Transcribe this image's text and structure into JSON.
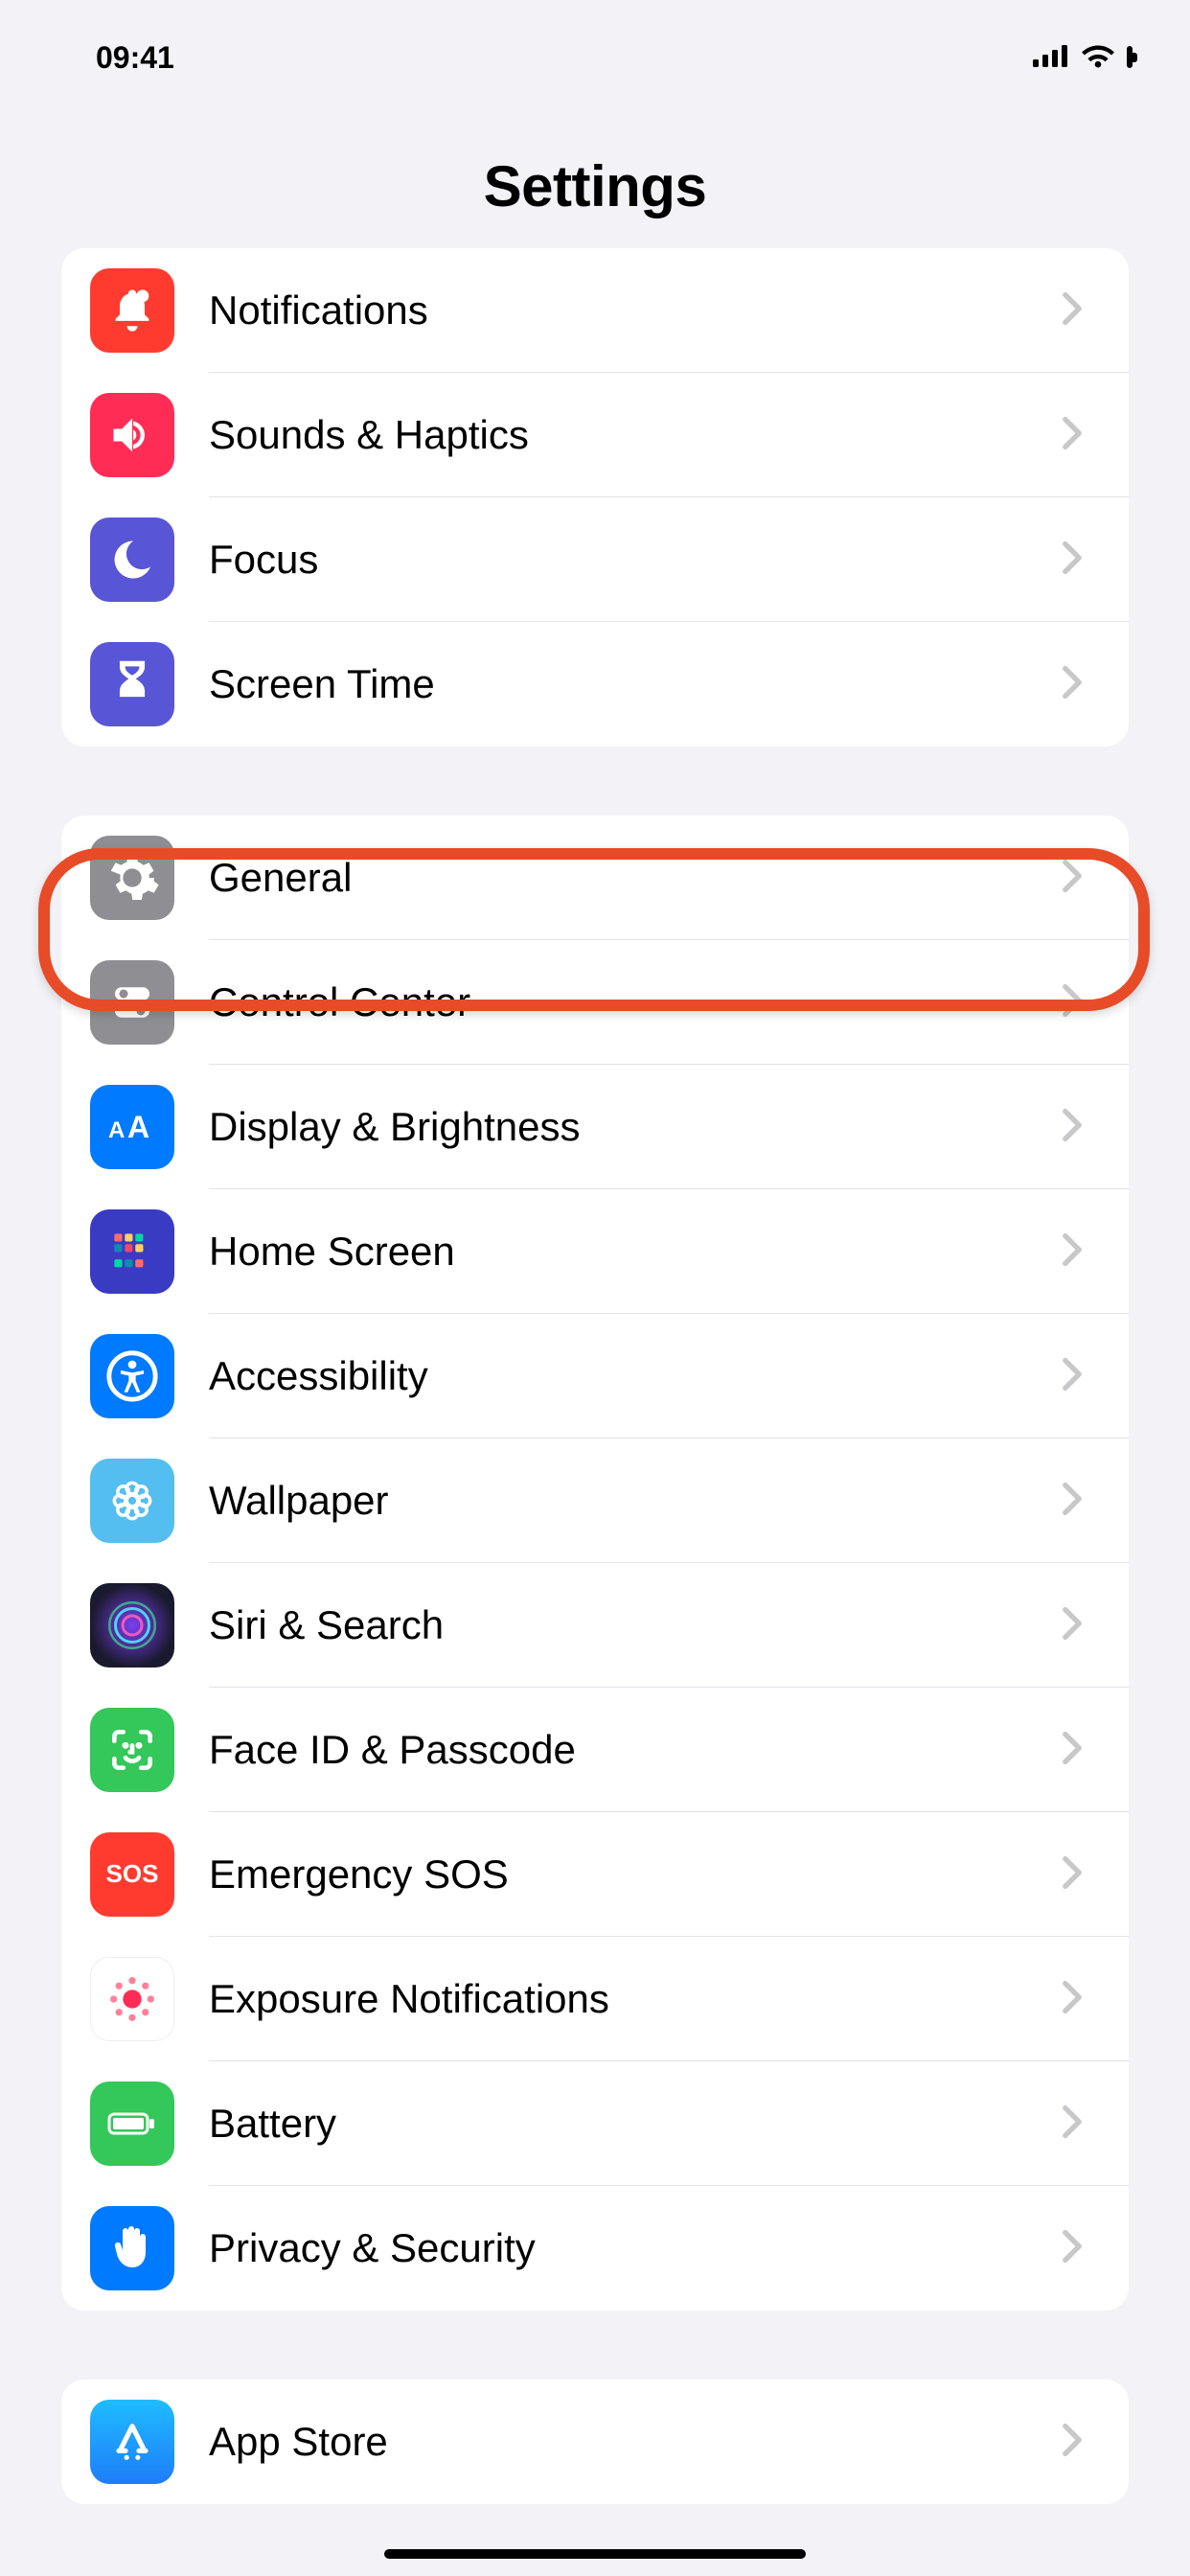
{
  "status": {
    "time": "09:41"
  },
  "header": {
    "title": "Settings"
  },
  "groups": [
    {
      "rows": [
        {
          "id": "notifications",
          "label": "Notifications",
          "icon": "bell-icon",
          "bg": "#ff3b30"
        },
        {
          "id": "sounds",
          "label": "Sounds & Haptics",
          "icon": "speaker-icon",
          "bg": "#ff2d55"
        },
        {
          "id": "focus",
          "label": "Focus",
          "icon": "moon-icon",
          "bg": "#5856d6"
        },
        {
          "id": "screentime",
          "label": "Screen Time",
          "icon": "hourglass-icon",
          "bg": "#5856d6"
        }
      ]
    },
    {
      "rows": [
        {
          "id": "general",
          "label": "General",
          "icon": "gear-icon",
          "bg": "#8e8e93",
          "highlight": true
        },
        {
          "id": "controlcenter",
          "label": "Control Center",
          "icon": "toggles-icon",
          "bg": "#8e8e93"
        },
        {
          "id": "display",
          "label": "Display & Brightness",
          "icon": "aa-icon",
          "bg": "#007aff"
        },
        {
          "id": "homescreen",
          "label": "Home Screen",
          "icon": "grid-icon",
          "bg": "#3a3bc3"
        },
        {
          "id": "accessibility",
          "label": "Accessibility",
          "icon": "accessibility-icon",
          "bg": "#007aff"
        },
        {
          "id": "wallpaper",
          "label": "Wallpaper",
          "icon": "flower-icon",
          "bg": "#55bef0"
        },
        {
          "id": "siri",
          "label": "Siri & Search",
          "icon": "siri-icon",
          "bg": "#000000"
        },
        {
          "id": "faceid",
          "label": "Face ID & Passcode",
          "icon": "faceid-icon",
          "bg": "#34c759"
        },
        {
          "id": "sos",
          "label": "Emergency SOS",
          "icon": "sos-icon",
          "bg": "#ff3b30"
        },
        {
          "id": "exposure",
          "label": "Exposure Notifications",
          "icon": "exposure-icon",
          "bg": "#ffffff"
        },
        {
          "id": "battery",
          "label": "Battery",
          "icon": "battery-icon",
          "bg": "#34c759"
        },
        {
          "id": "privacy",
          "label": "Privacy & Security",
          "icon": "hand-icon",
          "bg": "#007aff"
        }
      ]
    },
    {
      "rows": [
        {
          "id": "appstore",
          "label": "App Store",
          "icon": "appstore-icon",
          "bg": "#1f9ff8"
        }
      ]
    }
  ]
}
